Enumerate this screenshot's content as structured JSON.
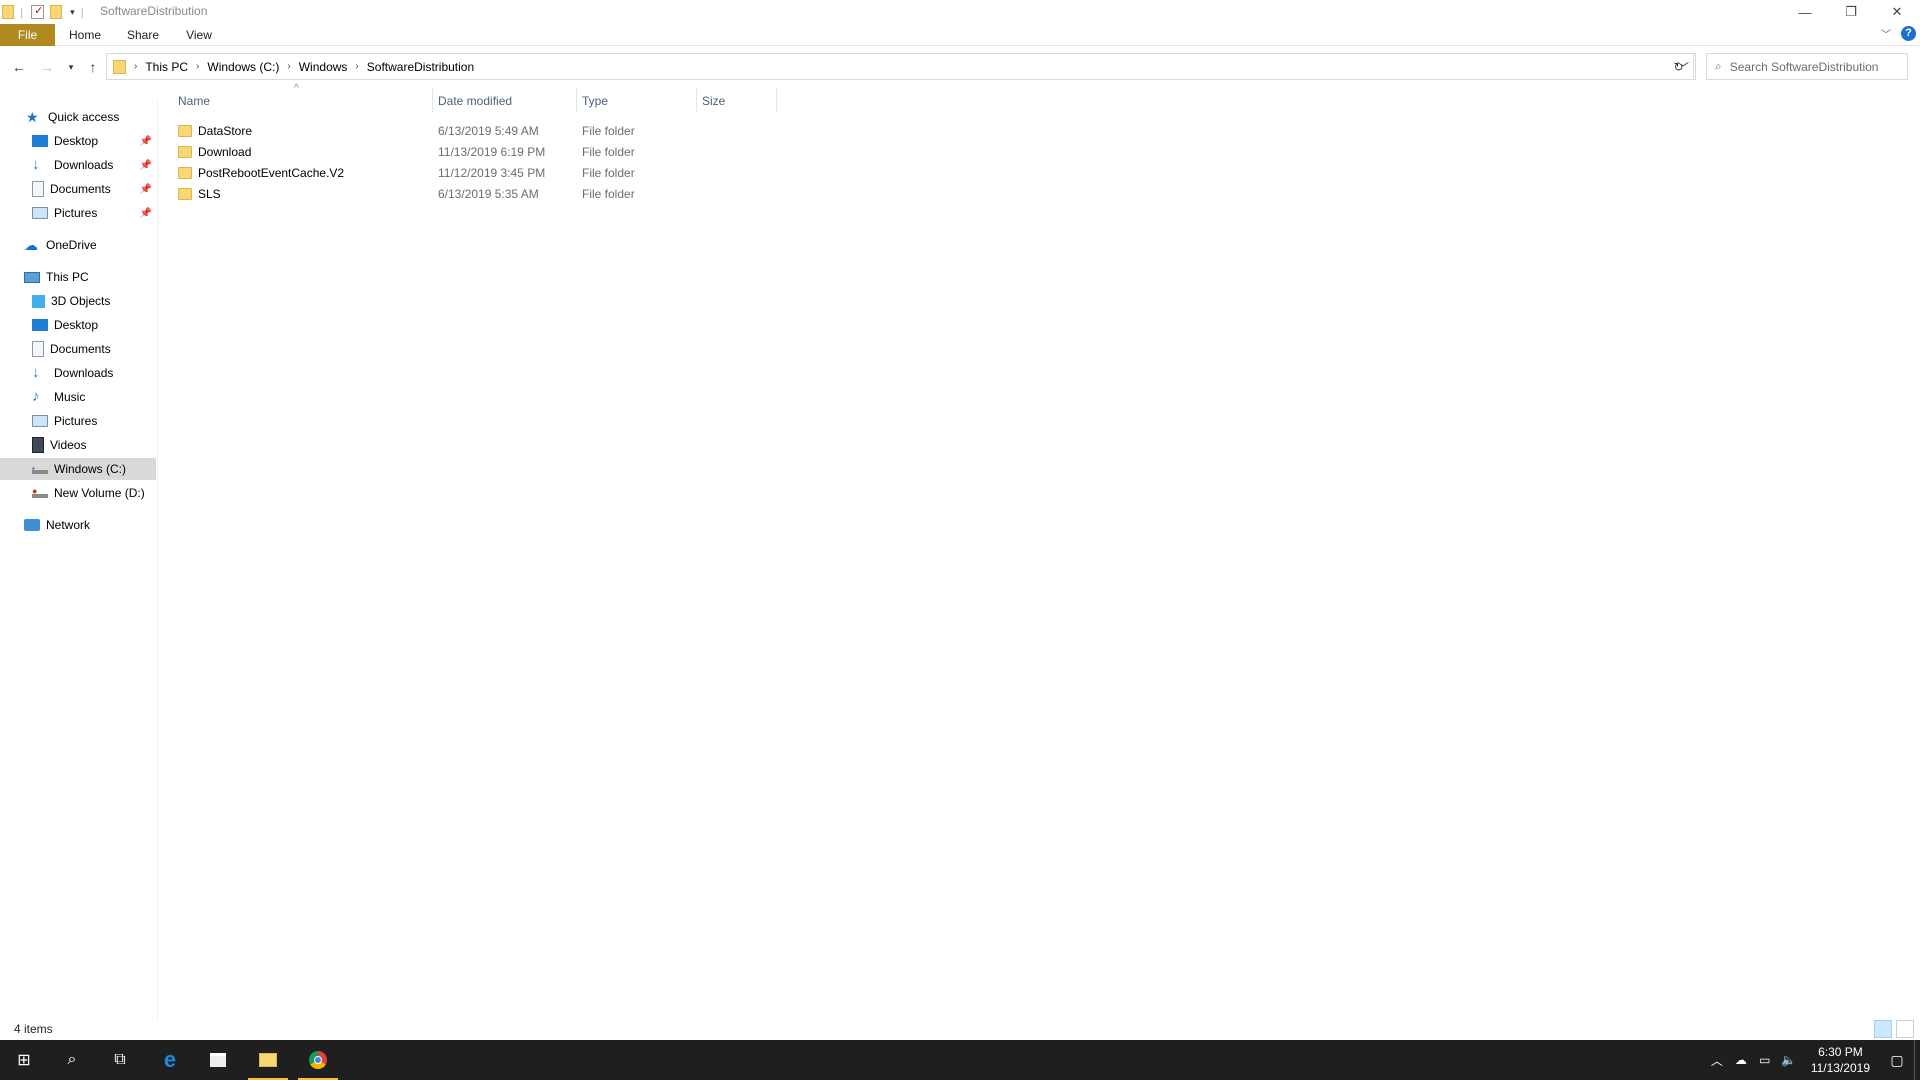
{
  "window": {
    "title": "SoftwareDistribution",
    "minimize_icon": "minimize-icon",
    "restore_icon": "restore-icon",
    "close_icon": "close-icon"
  },
  "ribbon": {
    "tabs": [
      "File",
      "Home",
      "Share",
      "View"
    ],
    "accent": "#b08a1e"
  },
  "address": {
    "crumbs": [
      "This PC",
      "Windows (C:)",
      "Windows",
      "SoftwareDistribution"
    ],
    "search_placeholder": "Search SoftwareDistribution"
  },
  "nav": {
    "quick_access": "Quick access",
    "quick_items": [
      "Desktop",
      "Downloads",
      "Documents",
      "Pictures"
    ],
    "onedrive": "OneDrive",
    "this_pc": "This PC",
    "pc_items": [
      "3D Objects",
      "Desktop",
      "Documents",
      "Downloads",
      "Music",
      "Pictures",
      "Videos",
      "Windows (C:)",
      "New Volume (D:)"
    ],
    "network": "Network",
    "selected": "Windows (C:)"
  },
  "columns": {
    "name": "Name",
    "date": "Date modified",
    "type": "Type",
    "size": "Size"
  },
  "files": [
    {
      "name": "DataStore",
      "date": "6/13/2019 5:49 AM",
      "type": "File folder"
    },
    {
      "name": "Download",
      "date": "11/13/2019 6:19 PM",
      "type": "File folder"
    },
    {
      "name": "PostRebootEventCache.V2",
      "date": "11/12/2019 3:45 PM",
      "type": "File folder"
    },
    {
      "name": "SLS",
      "date": "6/13/2019 5:35 AM",
      "type": "File folder"
    }
  ],
  "status": {
    "count": "4 items"
  },
  "taskbar": {
    "time": "6:30 PM",
    "date": "11/13/2019"
  }
}
